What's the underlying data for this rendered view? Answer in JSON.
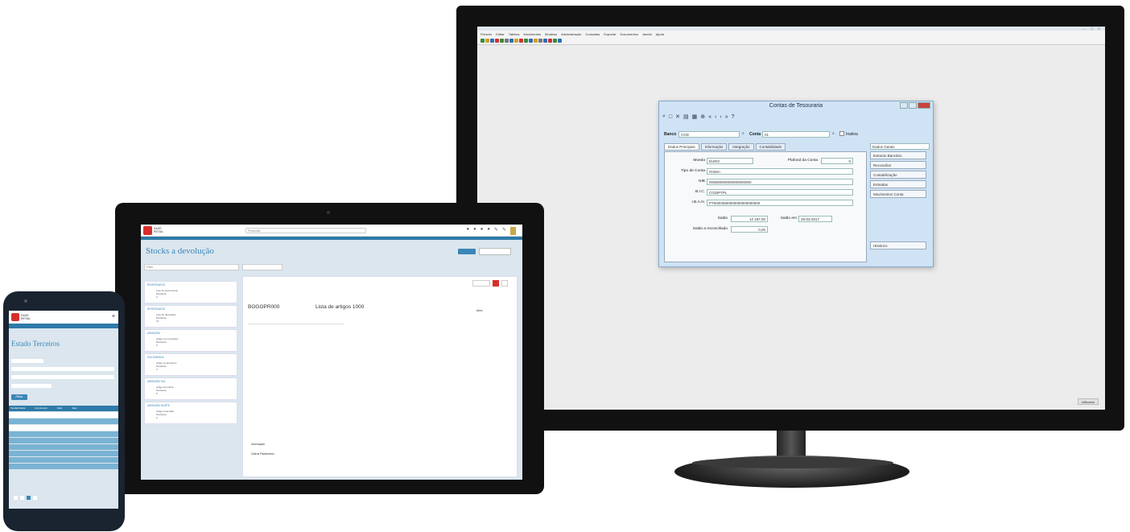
{
  "monitor": {
    "menu": [
      "Ficheiro",
      "Editar",
      "Tabelas",
      "Movimentos",
      "Modelos",
      "Administração",
      "Consultas",
      "Exportar",
      "Documentos",
      "Janela",
      "Ajuda"
    ],
    "status_button": "Utilizador",
    "dialog": {
      "title": "Contas de Tesouraria",
      "banco_label": "Banco",
      "banco_value": "CGD",
      "conta_label": "Conta",
      "conta_value": "01",
      "inativa_label": "Inativa",
      "tabs": [
        "Dados Principais",
        "Informação",
        "Integração",
        "Contabilidade"
      ],
      "side_select": "Dados Gerais",
      "moeda_label": "Moeda",
      "moeda_value": "EURO",
      "plafond_label": "Plafond da Conta",
      "plafond_value": "0",
      "tipo_label": "Tipo de Conta",
      "tipo_value": "Ordem",
      "nib_label": "NIB",
      "nib_value": "003500000000000000000",
      "bic_label": "B.I.C.",
      "bic_value": "CGDIPTPL",
      "iban_label": "I.B.A.N.",
      "iban_value": "PT50003500000000000000000",
      "saldo_label": "Saldo",
      "saldo_value": "12 197,00",
      "saldo_data_label": "Saldo em",
      "saldo_data_value": "25-03-2017",
      "saldo_rec_label": "Saldo a reconciliado",
      "saldo_rec_value": "0,00",
      "side_buttons": [
        "Extracto Bancário",
        "Reconciliar",
        "Contabilização",
        "Entradas",
        "Movimentos Conta"
      ],
      "bottom_button": "Histórico"
    }
  },
  "tablet": {
    "logo_text": "SAGE\nRETAIL",
    "search_placeholder": "Pesquisar",
    "page_title": "Stocks a devolução",
    "filter_value": "Filtro",
    "cards": [
      {
        "h": "RESERVADOS",
        "b": "Lote de encomenda\nPendente\n4"
      },
      {
        "h": "RESERVADOS",
        "b": "Lote de devolução\nPendente\n12"
      },
      {
        "h": "ARMAZÉM",
        "b": "Artigo com processo\nPendente\n6"
      },
      {
        "h": "ENCOMENDA",
        "b": "Artigo na armazém\nPendente\n3"
      },
      {
        "h": "ARMAZÉM SUL",
        "b": "Artigo sem linha\nPendente\n9"
      },
      {
        "h": "ARMAZÉM NORTE",
        "b": "Artigo reservado\nPendente\n2"
      }
    ],
    "main": {
      "code": "BOGOPR000",
      "name": "Lista de artigos 1000",
      "status": "Ativo",
      "section1": "Informação",
      "section2": "Outros Parâmetros"
    }
  },
  "phone": {
    "logo_text": "SAGE\nRETAIL",
    "title": "Estado Terceiros",
    "button": "Filtrar",
    "columns": [
      "Tipo/Entidade",
      "Documento",
      "Data",
      "Valor"
    ]
  }
}
